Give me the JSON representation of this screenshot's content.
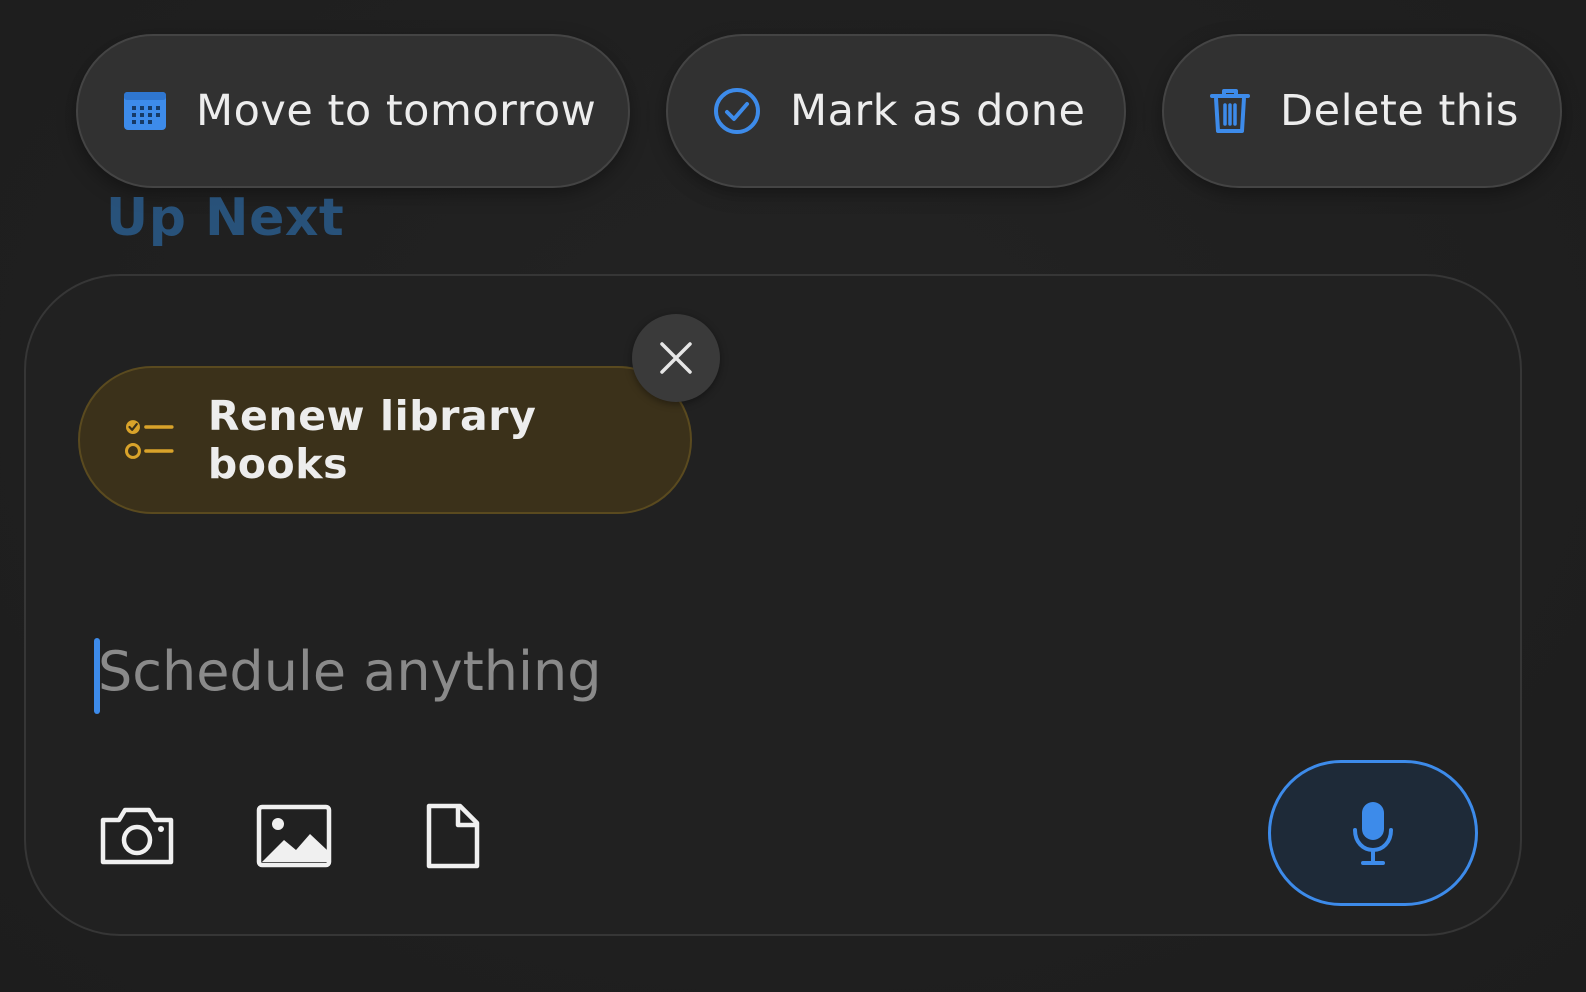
{
  "actions": [
    {
      "label": "Move to tomorrow",
      "icon": "calendar-icon"
    },
    {
      "label": "Mark as done",
      "icon": "check-circle-icon"
    },
    {
      "label": "Delete this",
      "icon": "trash-icon"
    }
  ],
  "section": {
    "title": "Up Next"
  },
  "composer": {
    "chip": {
      "label": "Renew library books",
      "icon": "checklist-icon",
      "close_icon": "close-icon"
    },
    "input": {
      "placeholder": "Schedule anything",
      "value": ""
    },
    "tools": [
      {
        "icon": "camera-icon"
      },
      {
        "icon": "image-icon"
      },
      {
        "icon": "file-icon"
      }
    ],
    "mic_icon": "microphone-icon"
  },
  "colors": {
    "background": "#1f1f1f",
    "accent": "#3d8bea",
    "chip_bg": "#3b311a",
    "chip_icon": "#d9a32a",
    "section_title": "#2a5b8a"
  }
}
